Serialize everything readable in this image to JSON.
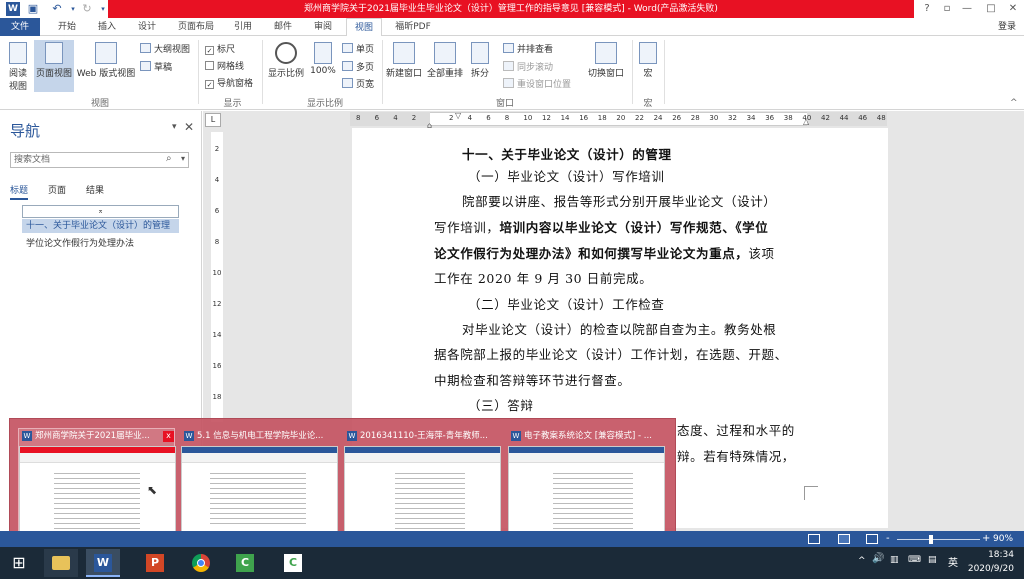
{
  "window": {
    "title": "郑州商学院关于2021届毕业生毕业论文（设计）管理工作的指导意见 [兼容模式] - Word(产品激活失败)",
    "signin": "登录",
    "help": "?",
    "min": "—",
    "restore": "□",
    "close": "✕"
  },
  "tabs": [
    "文件",
    "开始",
    "插入",
    "设计",
    "页面布局",
    "引用",
    "邮件",
    "审阅",
    "视图",
    "福昕PDF"
  ],
  "ribbon": {
    "views": {
      "read": "阅读\n视图",
      "print": "页面视图",
      "web": "Web 版式视图",
      "outline": "大纲视图",
      "draft": "草稿",
      "group": "视图"
    },
    "show": {
      "ruler": "标尺",
      "grid": "网格线",
      "navpane": "导航窗格",
      "group": "显示"
    },
    "zoom": {
      "zoom": "显示比例",
      "hundred": "100%",
      "single": "单页",
      "multi": "多页",
      "width": "页宽",
      "group": "显示比例"
    },
    "window": {
      "new": "新建窗口",
      "arrange": "全部重排",
      "split": "拆分",
      "sidebyside": "并排查看",
      "sync": "同步滚动",
      "reset": "重设窗口位置",
      "switch": "切换窗口",
      "group": "窗口"
    },
    "macro": {
      "macro": "宏",
      "group": "宏"
    }
  },
  "nav": {
    "title": "导航",
    "search_placeholder": "搜索文档",
    "tabs": [
      "标题",
      "页面",
      "结果"
    ],
    "items": [
      "十一、关于毕业论文（设计）的管理",
      "学位论文作假行为处理办法"
    ]
  },
  "ruler": {
    "marks": [
      "8",
      "6",
      "4",
      "2",
      "",
      "2",
      "4",
      "6",
      "8",
      "10",
      "12",
      "14",
      "16",
      "18",
      "20",
      "22",
      "24",
      "26",
      "28",
      "30",
      "32",
      "34",
      "36",
      "38",
      "40",
      "42",
      "44",
      "46",
      "48"
    ],
    "vmarks": [
      "2",
      "4",
      "6",
      "8",
      "10",
      "12",
      "14",
      "16",
      "18"
    ]
  },
  "doc": {
    "h1": "十一、关于毕业论文（设计）的管理",
    "h2a": "（一）毕业论文（设计）写作培训",
    "p1a": "院部要以讲座、报告等形式分别开展毕业论文（设计）",
    "p1b_pre": "写作培训，",
    "p1b_bold": "培训内容以毕业论文（设计）写作规范、《学位",
    "p1c_bold": "论文作假行为处理办法》和如何撰写毕业论文为重点，",
    "p1c_post": "该项",
    "p1d": "工作在 2020 年 9 月 30 日前完成。",
    "h2b": "（二）毕业论文（设计）工作检查",
    "p2a": "对毕业论文（设计）的检查以院部自查为主。教务处根",
    "p2b": "据各院部上报的毕业论文（设计）工作计划，在选题、开题、",
    "p2c": "中期检查和答辩等环节进行督查。",
    "h2c": "（三）答辩",
    "p3a_tail": "态度、过程和水平的",
    "p3b_tail": "辩。若有特殊情况，"
  },
  "thumbs": [
    {
      "title": "郑州商学院关于2021届毕业...",
      "close": "x"
    },
    {
      "title": "5.1 信息与机电工程学院毕业论..."
    },
    {
      "title": "2016341110-王海萍-青年教师..."
    },
    {
      "title": "电子教案系统论文 [兼容模式] - ..."
    }
  ],
  "status": {
    "zoom": "90%",
    "minus": "-",
    "plus": "+"
  },
  "tray": {
    "time": "18:34",
    "date": "2020/9/20",
    "lang": "英",
    "chevron": "^",
    "volume": "🔊",
    "ime": "⌨"
  },
  "taskbar_apps": [
    "start",
    "file-explorer",
    "word",
    "powerpoint",
    "chrome",
    "camtasia-1",
    "camtasia-2"
  ],
  "colors": {
    "word_blue": "#2b579a",
    "title_red": "#e81123",
    "taskbar": "#1b2a38"
  }
}
